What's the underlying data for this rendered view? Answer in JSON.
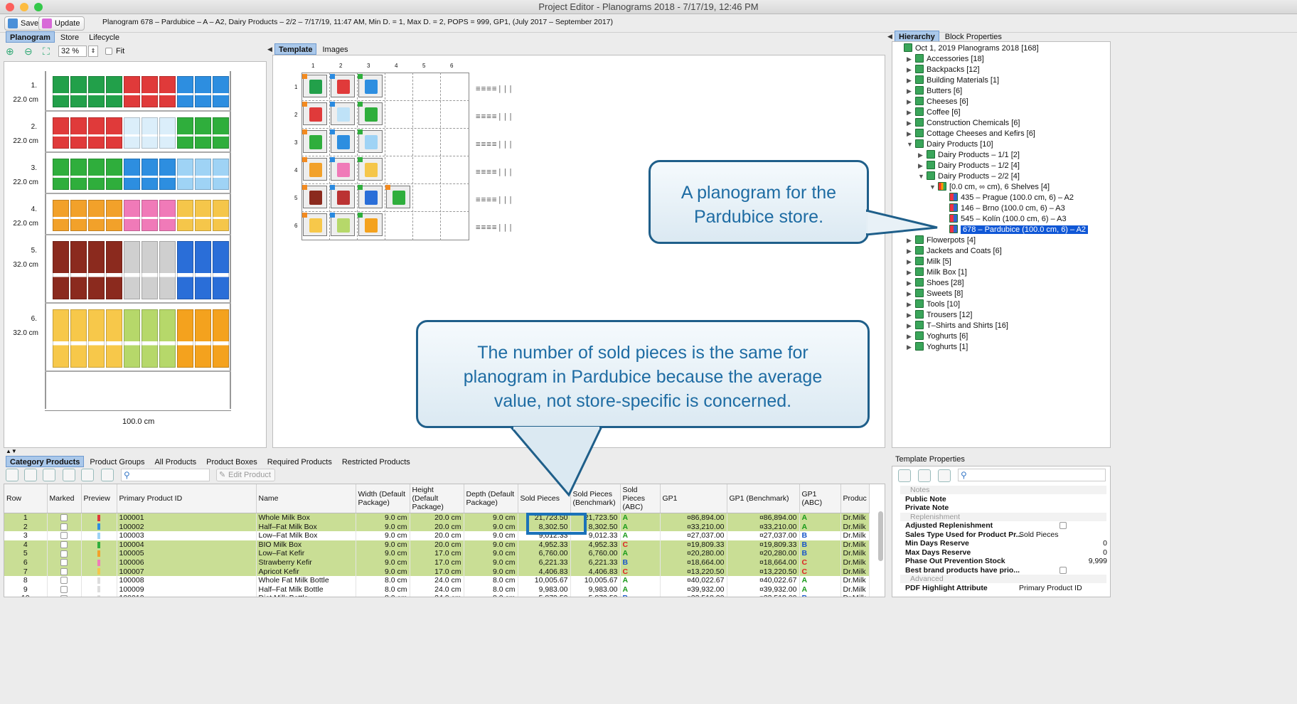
{
  "window": {
    "title": "Project Editor - Planograms 2018 - 7/17/19, 12:46 PM"
  },
  "toolbar": {
    "save": "Save",
    "update": "Update",
    "info": "Planogram 678 – Pardubice – A – A2, Dairy Products – 2/2 – 7/17/19, 11:47 AM, Min D. = 1, Max D. = 2, POPS = 999, GP1, (July 2017 – September 2017)"
  },
  "left_tabs": [
    "Planogram",
    "Store",
    "Lifecycle"
  ],
  "zoom": {
    "value": "32 %",
    "fit": "Fit"
  },
  "shelves": [
    {
      "num": "1.",
      "height": "22.0 cm",
      "colors": [
        "#22a04a",
        "#e03a3a",
        "#2d8ee0"
      ]
    },
    {
      "num": "2.",
      "height": "22.0 cm",
      "colors": [
        "#e03a3a",
        "#dbeefa",
        "#2fae3c"
      ]
    },
    {
      "num": "3.",
      "height": "22.0 cm",
      "colors": [
        "#2fae3c",
        "#2d8ee0",
        "#9fd3f5"
      ]
    },
    {
      "num": "4.",
      "height": "22.0 cm",
      "colors": [
        "#f2a12a",
        "#f07ab8",
        "#f5c64a"
      ]
    },
    {
      "num": "5.",
      "height": "32.0 cm",
      "colors": [
        "#8b2a1e",
        "#cfcfcf",
        "#2a6ed8"
      ]
    },
    {
      "num": "6.",
      "height": "32.0 cm",
      "colors": [
        "#f7c84a",
        "#b6d86a",
        "#f4a21e"
      ]
    }
  ],
  "width_label": "100.0 cm",
  "center_tabs": [
    "Template",
    "Images"
  ],
  "template_cols": [
    "1",
    "2",
    "3",
    "4",
    "5",
    "6"
  ],
  "template_rows": [
    "1",
    "2",
    "3",
    "4",
    "5",
    "6"
  ],
  "hierarchy_tabs": [
    "Hierarchy",
    "Block Properties"
  ],
  "tree": [
    {
      "label": "Oct 1, 2019 Planograms 2018 [168]",
      "depth": 0,
      "tri": "",
      "icon": "root-icon"
    },
    {
      "label": "Accessories [18]",
      "depth": 1,
      "tri": "▶",
      "icon": "category-icon"
    },
    {
      "label": "Backpacks [12]",
      "depth": 1,
      "tri": "▶",
      "icon": "category-icon"
    },
    {
      "label": "Building Materials [1]",
      "depth": 1,
      "tri": "▶",
      "icon": "category-icon"
    },
    {
      "label": "Butters [6]",
      "depth": 1,
      "tri": "▶",
      "icon": "category-icon"
    },
    {
      "label": "Cheeses [6]",
      "depth": 1,
      "tri": "▶",
      "icon": "category-icon"
    },
    {
      "label": "Coffee [6]",
      "depth": 1,
      "tri": "▶",
      "icon": "category-icon"
    },
    {
      "label": "Construction Chemicals [6]",
      "depth": 1,
      "tri": "▶",
      "icon": "category-icon"
    },
    {
      "label": "Cottage Cheeses and Kefirs [6]",
      "depth": 1,
      "tri": "▶",
      "icon": "category-icon"
    },
    {
      "label": "Dairy Products [10]",
      "depth": 1,
      "tri": "▼",
      "icon": "category-icon"
    },
    {
      "label": "Dairy Products – 1/1 [2]",
      "depth": 2,
      "tri": "▶",
      "icon": "category-icon"
    },
    {
      "label": "Dairy Products – 1/2 [4]",
      "depth": 2,
      "tri": "▶",
      "icon": "category-icon"
    },
    {
      "label": "Dairy Products – 2/2 [4]",
      "depth": 2,
      "tri": "▼",
      "icon": "category-icon"
    },
    {
      "label": "[0.0 cm, ∞ cm), 6 Shelves [4]",
      "depth": 3,
      "tri": "▼",
      "icon": "shelves-icon"
    },
    {
      "label": "435 – Prague (100.0 cm, 6) – A2",
      "depth": 4,
      "tri": "",
      "icon": "planogram-icon"
    },
    {
      "label": "146 – Brno (100.0 cm, 6) – A3",
      "depth": 4,
      "tri": "",
      "icon": "planogram-icon"
    },
    {
      "label": "545 – Kolín (100.0 cm, 6) – A3",
      "depth": 4,
      "tri": "",
      "icon": "planogram-icon"
    },
    {
      "label": "678 – Pardubice  (100.0 cm, 6) – A2",
      "depth": 4,
      "tri": "",
      "icon": "planogram-icon",
      "selected": true
    },
    {
      "label": "Flowerpots [4]",
      "depth": 1,
      "tri": "▶",
      "icon": "category-icon"
    },
    {
      "label": "Jackets and Coats [6]",
      "depth": 1,
      "tri": "▶",
      "icon": "category-icon"
    },
    {
      "label": "Milk [5]",
      "depth": 1,
      "tri": "▶",
      "icon": "category-icon"
    },
    {
      "label": "Milk Box [1]",
      "depth": 1,
      "tri": "▶",
      "icon": "category-icon"
    },
    {
      "label": "Shoes [28]",
      "depth": 1,
      "tri": "▶",
      "icon": "category-icon"
    },
    {
      "label": "Sweets [8]",
      "depth": 1,
      "tri": "▶",
      "icon": "category-icon"
    },
    {
      "label": "Tools [10]",
      "depth": 1,
      "tri": "▶",
      "icon": "category-icon"
    },
    {
      "label": "Trousers [12]",
      "depth": 1,
      "tri": "▶",
      "icon": "category-icon"
    },
    {
      "label": "T–Shirts and Shirts [16]",
      "depth": 1,
      "tri": "▶",
      "icon": "category-icon"
    },
    {
      "label": "Yoghurts [6]",
      "depth": 1,
      "tri": "▶",
      "icon": "category-icon"
    },
    {
      "label": "Yoghurts [1]",
      "depth": 1,
      "tri": "▶",
      "icon": "category-icon"
    }
  ],
  "callouts": {
    "pardubice": "A planogram for the Pardubice store.",
    "sold": "The number of sold pieces is the same for planogram in Pardubice because the average value, not store-specific is concerned."
  },
  "bottom_tabs": [
    "Category Products",
    "Product Groups",
    "All Products",
    "Product Boxes",
    "Required Products",
    "Restricted Products"
  ],
  "edit_product": "Edit Product",
  "columns": [
    "Row",
    "Marked",
    "Preview",
    "Primary Product ID",
    "Name",
    "Width (Default Package)",
    "Height (Default Package)",
    "Depth (Default Package)",
    "Sold Pieces",
    "Sold Pieces (Benchmark)",
    "Sold Pieces (ABC)",
    "GP1",
    "GP1 (Benchmark)",
    "GP1 (ABC)",
    "Produc"
  ],
  "rows": [
    {
      "row": "1",
      "id": "100001",
      "name": "Whole Milk Box",
      "w": "9.0 cm",
      "h": "20.0 cm",
      "d": "9.0 cm",
      "sold": "21,723.50",
      "bench": "21,723.50",
      "abc": "A",
      "gp1": "¤86,894.00",
      "gp1b": "¤86,894.00",
      "gabc": "A",
      "prod": "Dr.Milk",
      "hl": true,
      "pv": "#e03a3a"
    },
    {
      "row": "2",
      "id": "100002",
      "name": "Half–Fat Milk Box",
      "w": "9.0 cm",
      "h": "20.0 cm",
      "d": "9.0 cm",
      "sold": "8,302.50",
      "bench": "8,302.50",
      "abc": "A",
      "gp1": "¤33,210.00",
      "gp1b": "¤33,210.00",
      "gabc": "A",
      "prod": "Dr.Milk",
      "hl": true,
      "pv": "#2d8ee0"
    },
    {
      "row": "3",
      "id": "100003",
      "name": "Low–Fat Milk Box",
      "w": "9.0 cm",
      "h": "20.0 cm",
      "d": "9.0 cm",
      "sold": "9,012.33",
      "bench": "9,012.33",
      "abc": "A",
      "gp1": "¤27,037.00",
      "gp1b": "¤27,037.00",
      "gabc": "B",
      "prod": "Dr.Milk",
      "hl": false,
      "pv": "#9fd3f5"
    },
    {
      "row": "4",
      "id": "100004",
      "name": "BIO Milk Box",
      "w": "9.0 cm",
      "h": "20.0 cm",
      "d": "9.0 cm",
      "sold": "4,952.33",
      "bench": "4,952.33",
      "abc": "C",
      "gp1": "¤19,809.33",
      "gp1b": "¤19,809.33",
      "gabc": "B",
      "prod": "Dr.Milk",
      "hl": true,
      "pv": "#2fae3c"
    },
    {
      "row": "5",
      "id": "100005",
      "name": "Low–Fat Kefir",
      "w": "9.0 cm",
      "h": "17.0 cm",
      "d": "9.0 cm",
      "sold": "6,760.00",
      "bench": "6,760.00",
      "abc": "A",
      "gp1": "¤20,280.00",
      "gp1b": "¤20,280.00",
      "gabc": "B",
      "prod": "Dr.Milk",
      "hl": true,
      "pv": "#f2a12a"
    },
    {
      "row": "6",
      "id": "100006",
      "name": "Strawberry Kefir",
      "w": "9.0 cm",
      "h": "17.0 cm",
      "d": "9.0 cm",
      "sold": "6,221.33",
      "bench": "6,221.33",
      "abc": "B",
      "gp1": "¤18,664.00",
      "gp1b": "¤18,664.00",
      "gabc": "C",
      "prod": "Dr.Milk",
      "hl": true,
      "pv": "#f07ab8"
    },
    {
      "row": "7",
      "id": "100007",
      "name": "Apricot Kefir",
      "w": "9.0 cm",
      "h": "17.0 cm",
      "d": "9.0 cm",
      "sold": "4,406.83",
      "bench": "4,406.83",
      "abc": "C",
      "gp1": "¤13,220.50",
      "gp1b": "¤13,220.50",
      "gabc": "C",
      "prod": "Dr.Milk",
      "hl": true,
      "pv": "#f5c64a"
    },
    {
      "row": "8",
      "id": "100008",
      "name": "Whole Fat Milk Bottle",
      "w": "8.0 cm",
      "h": "24.0 cm",
      "d": "8.0 cm",
      "sold": "10,005.67",
      "bench": "10,005.67",
      "abc": "A",
      "gp1": "¤40,022.67",
      "gp1b": "¤40,022.67",
      "gabc": "A",
      "prod": "Dr.Milk",
      "hl": false,
      "pv": "#dddddd"
    },
    {
      "row": "9",
      "id": "100009",
      "name": "Half–Fat Milk Bottle",
      "w": "8.0 cm",
      "h": "24.0 cm",
      "d": "8.0 cm",
      "sold": "9,983.00",
      "bench": "9,983.00",
      "abc": "A",
      "gp1": "¤39,932.00",
      "gp1b": "¤39,932.00",
      "gabc": "A",
      "prod": "Dr.Milk",
      "hl": false,
      "pv": "#dddddd"
    },
    {
      "row": "10",
      "id": "100010",
      "name": "Diet Milk Bottle",
      "w": "8.0 cm",
      "h": "24.0 cm",
      "d": "8.0 cm",
      "sold": "5,879.50",
      "bench": "5,879.50",
      "abc": "B",
      "gp1": "¤23,518.00",
      "gp1b": "¤23,518.00",
      "gabc": "B",
      "prod": "Dr.Milk",
      "hl": false,
      "pv": "#dddddd"
    }
  ],
  "template_props": {
    "title": "Template Properties",
    "sections": [
      {
        "name": "Notes",
        "items": [
          {
            "k": "Public Note",
            "v": ""
          },
          {
            "k": "Private Note",
            "v": ""
          }
        ]
      },
      {
        "name": "Replenishment",
        "items": [
          {
            "k": "Adjusted Replenishment",
            "v": "",
            "check": true
          },
          {
            "k": "Sales Type Used for Product Pr...",
            "v": "Sold Pieces"
          },
          {
            "k": "Min Days Reserve",
            "v": "0"
          },
          {
            "k": "Max Days Reserve",
            "v": "0"
          },
          {
            "k": "Phase Out Prevention Stock",
            "v": "9,999"
          },
          {
            "k": "Best brand products have prio...",
            "v": "",
            "check": true
          }
        ]
      },
      {
        "name": "Advanced",
        "items": [
          {
            "k": "PDF Highlight Attribute",
            "v": "Primary Product ID"
          }
        ]
      }
    ]
  },
  "colors": {
    "accent": "#1057d6",
    "highlight_row": "#c9de95",
    "callout_border": "#1f5f8a",
    "callout_text": "#1e6ca3"
  }
}
